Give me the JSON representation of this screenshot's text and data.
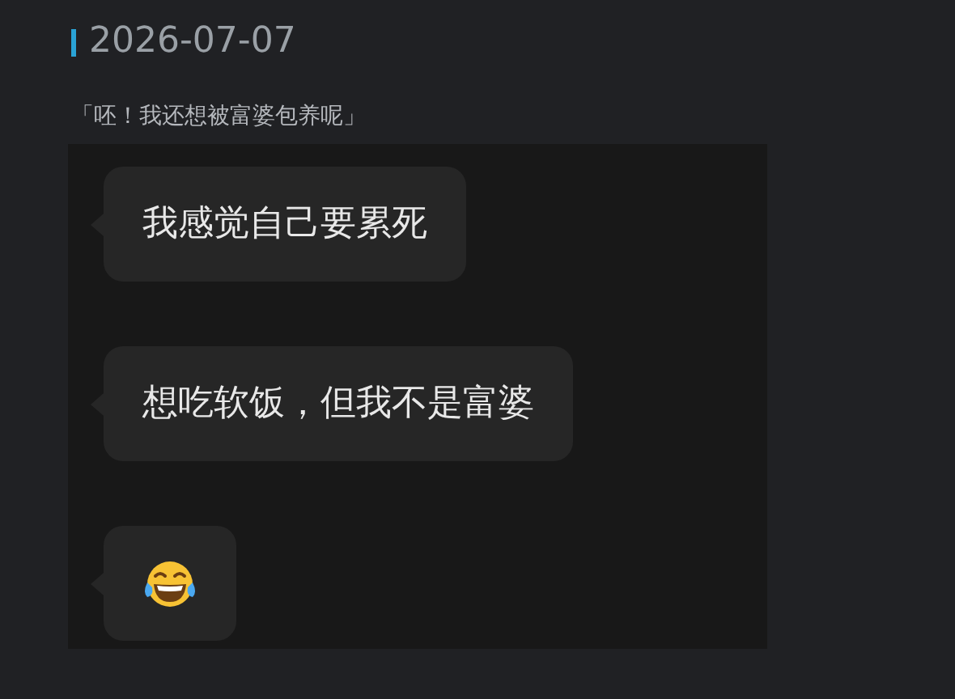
{
  "date": "2026-07-07",
  "quote": "「呸！我还想被富婆包养呢」",
  "messages": [
    {
      "kind": "text",
      "text": "我感觉自己要累死"
    },
    {
      "kind": "text",
      "text": "想吃软饭，但我不是富婆"
    },
    {
      "kind": "emoji"
    }
  ]
}
